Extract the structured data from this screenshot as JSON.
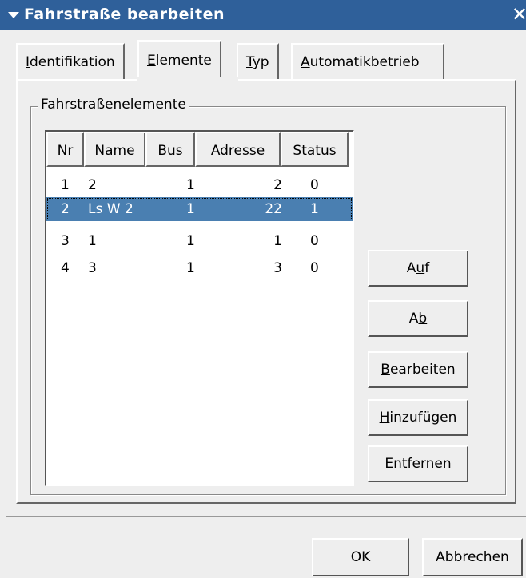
{
  "window": {
    "title": "Fahrstraße bearbeiten",
    "close_glyph": "✕"
  },
  "tabs": [
    {
      "label": "Identifikation",
      "mnemonic": "I",
      "rest": "dentifikation"
    },
    {
      "label": "Elemente",
      "mnemonic": "E",
      "rest": "lemente",
      "active": true
    },
    {
      "label": "Typ",
      "mnemonic": "T",
      "rest": "yp"
    },
    {
      "label": "Automatikbetrieb",
      "mnemonic": "A",
      "rest": "utomatikbetrieb"
    }
  ],
  "group": {
    "label": "Fahrstraßenelemente"
  },
  "table": {
    "columns": [
      "Nr",
      "Name",
      "Bus",
      "Adresse",
      "Status"
    ],
    "rows": [
      {
        "nr": "1",
        "name": "2",
        "bus": "1",
        "adresse": "2",
        "status": "0"
      },
      {
        "nr": "2",
        "name": "Ls W 2",
        "bus": "1",
        "adresse": "22",
        "status": "1",
        "selected": true
      },
      {
        "nr": "3",
        "name": "1",
        "bus": "1",
        "adresse": "1",
        "status": "0"
      },
      {
        "nr": "4",
        "name": "3",
        "bus": "1",
        "adresse": "3",
        "status": "0"
      }
    ]
  },
  "side_buttons": {
    "auf": {
      "pre": "A",
      "mnemonic": "u",
      "post": "f"
    },
    "ab": {
      "pre": "A",
      "mnemonic": "b",
      "post": ""
    },
    "bearbeiten": {
      "pre": "",
      "mnemonic": "B",
      "post": "earbeiten"
    },
    "hinzufuegen": {
      "pre": "",
      "mnemonic": "H",
      "post": "inzufügen"
    },
    "entfernen": {
      "pre": "",
      "mnemonic": "E",
      "post": "ntfernen"
    }
  },
  "dialog_buttons": {
    "ok": "OK",
    "cancel": "Abbrechen"
  },
  "colors": {
    "titlebar": "#2f609a",
    "selection": "#4a7fb1",
    "background": "#eeeeee"
  }
}
